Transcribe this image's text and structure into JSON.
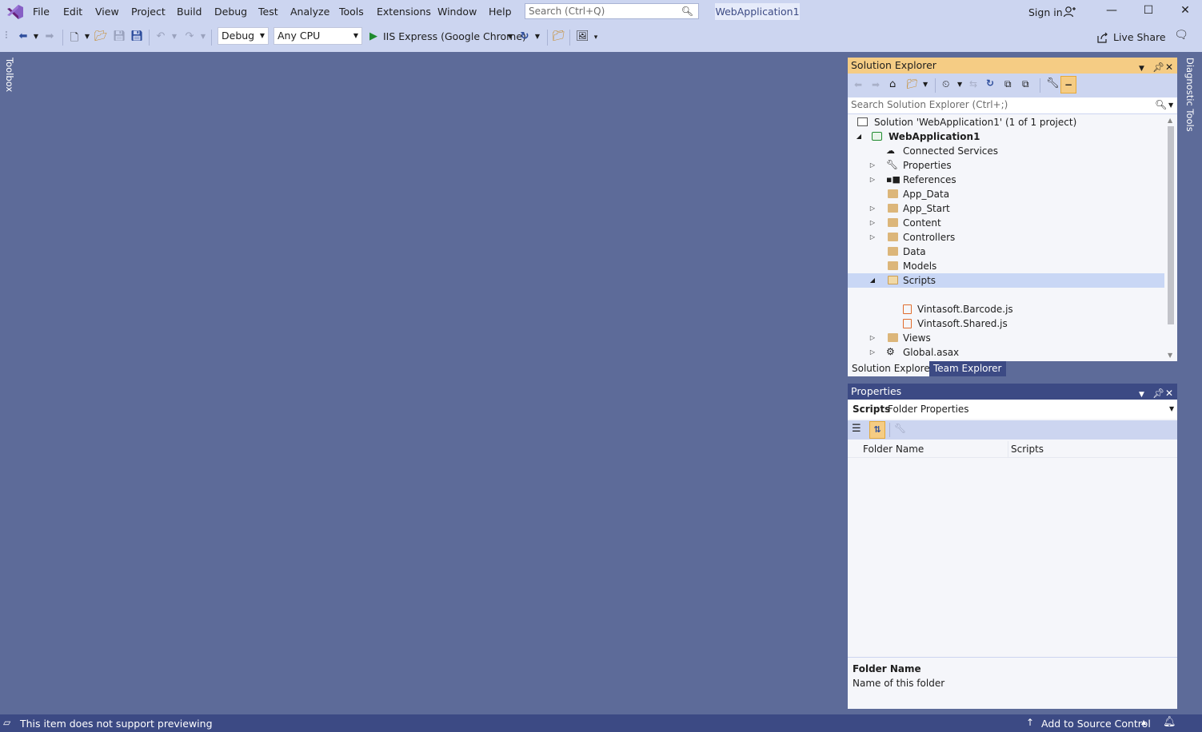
{
  "menu": [
    "File",
    "Edit",
    "View",
    "Project",
    "Build",
    "Debug",
    "Test",
    "Analyze",
    "Tools",
    "Extensions",
    "Window",
    "Help"
  ],
  "search": {
    "placeholder": "Search (Ctrl+Q)"
  },
  "project_name": "WebApplication1",
  "sign_in": "Sign in",
  "toolbar": {
    "config": "Debug",
    "platform": "Any CPU",
    "run_target": "IIS Express (Google Chrome)",
    "live_share": "Live Share"
  },
  "side_tabs": {
    "left": "Toolbox",
    "right": "Diagnostic Tools"
  },
  "solution_explorer": {
    "title": "Solution Explorer",
    "search_placeholder": "Search Solution Explorer (Ctrl+;)",
    "tree": [
      {
        "label": "Solution 'WebApplication1' (1 of 1 project)",
        "icon": "solution-icon"
      },
      {
        "label": "WebApplication1",
        "icon": "web-project-icon"
      },
      {
        "label": "Connected Services",
        "icon": "connected-services-icon"
      },
      {
        "label": "Properties",
        "icon": "wrench-icon"
      },
      {
        "label": "References",
        "icon": "references-icon"
      },
      {
        "label": "App_Data",
        "icon": "folder-icon"
      },
      {
        "label": "App_Start",
        "icon": "folder-icon"
      },
      {
        "label": "Content",
        "icon": "folder-icon"
      },
      {
        "label": "Controllers",
        "icon": "folder-icon"
      },
      {
        "label": "Data",
        "icon": "folder-icon"
      },
      {
        "label": "Models",
        "icon": "folder-icon"
      },
      {
        "label": "Scripts",
        "icon": "folder-open-icon"
      },
      {
        "label": "Vintasoft.Barcode.js",
        "icon": "js-file-icon"
      },
      {
        "label": "Vintasoft.Shared.js",
        "icon": "js-file-icon"
      },
      {
        "label": "Views",
        "icon": "folder-icon"
      },
      {
        "label": "Global.asax",
        "icon": "asax-file-icon"
      }
    ],
    "tabs": [
      "Solution Explorer",
      "Team Explorer"
    ]
  },
  "properties": {
    "title": "Properties",
    "object_name": "Scripts",
    "object_type": "Folder Properties",
    "rows": [
      {
        "name": "Folder Name",
        "value": "Scripts"
      }
    ],
    "desc_title": "Folder Name",
    "desc_text": "Name of this folder"
  },
  "status": {
    "message": "This item does not support previewing",
    "source_control": "Add to Source Control"
  },
  "colors": {
    "accent": "#3c4a84",
    "background": "#5d6b99",
    "chrome": "#ccd5f0",
    "active_tab": "#f5cc84"
  }
}
